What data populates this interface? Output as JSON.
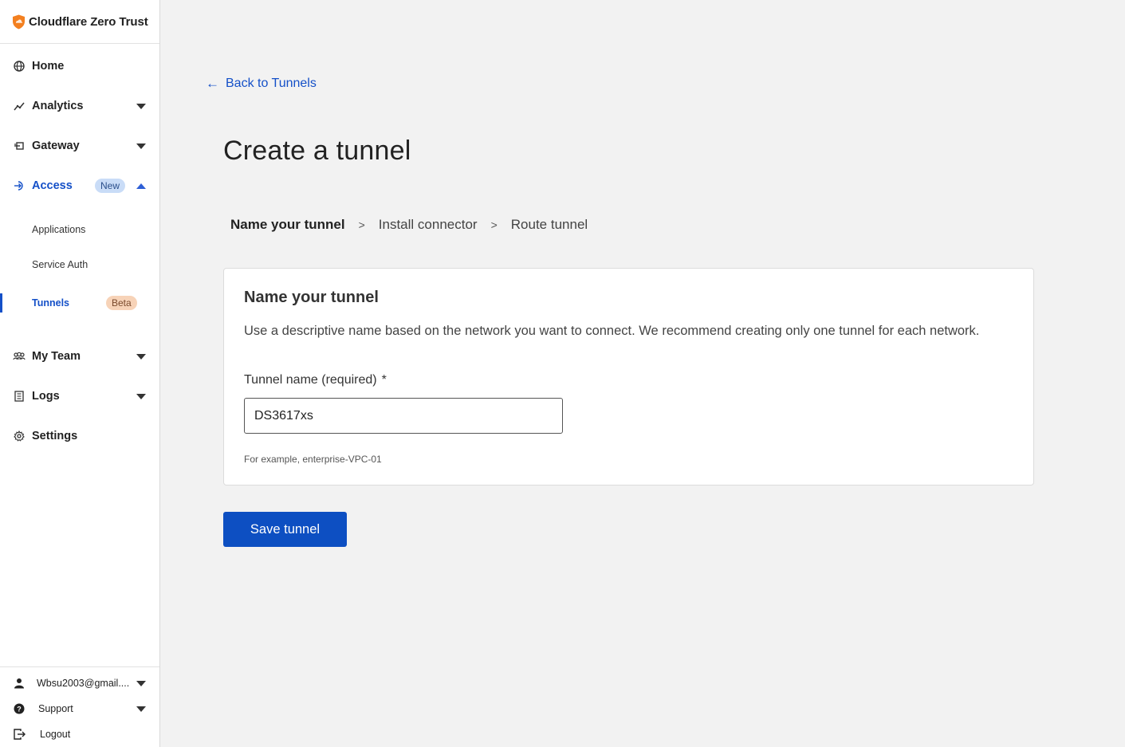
{
  "brand": {
    "name": "Cloudflare Zero Trust",
    "logo_icon": "cloudflare-shield-icon",
    "logo_color": "#f38020"
  },
  "sidebar": {
    "items": [
      {
        "label": "Home",
        "icon": "globe-icon"
      },
      {
        "label": "Analytics",
        "icon": "chart-line-icon"
      },
      {
        "label": "Gateway",
        "icon": "gateway-icon"
      },
      {
        "label": "Access",
        "icon": "access-icon",
        "badge": "New",
        "expanded": true
      },
      {
        "label": "My Team",
        "icon": "team-icon"
      },
      {
        "label": "Logs",
        "icon": "logs-icon"
      },
      {
        "label": "Settings",
        "icon": "gear-icon"
      }
    ],
    "access_subitems": [
      {
        "label": "Applications"
      },
      {
        "label": "Service Auth"
      },
      {
        "label": "Tunnels",
        "badge": "Beta",
        "active": true
      }
    ],
    "footer": {
      "account": "Wbsu2003@gmail....",
      "support": "Support",
      "logout": "Logout"
    }
  },
  "main": {
    "back_link": "Back to Tunnels",
    "back_arrow": "←",
    "title": "Create a tunnel",
    "steps": [
      "Name your tunnel",
      "Install connector",
      "Route tunnel"
    ],
    "step_separator": ">",
    "current_step": 0,
    "card": {
      "title": "Name your tunnel",
      "description": "Use a descriptive name based on the network you want to connect. We recommend creating only one tunnel for each network.",
      "field_label": "Tunnel name (required)",
      "required_mark": "*",
      "field_value": "DS3617xs",
      "field_help": "For example, enterprise-VPC-01"
    },
    "save_button": "Save tunnel"
  },
  "colors": {
    "accent": "#1450c8",
    "primary_button": "#0d4fc2",
    "badge_new": "#c9dcf7",
    "badge_beta": "#f7d3b8"
  }
}
